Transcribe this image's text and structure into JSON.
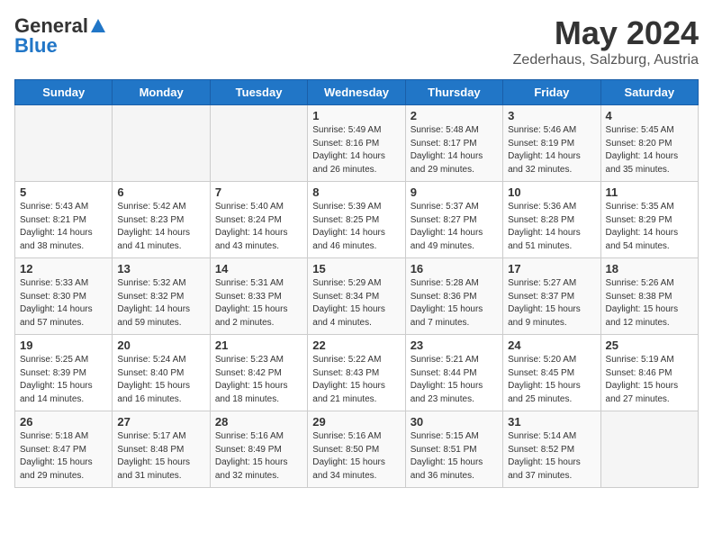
{
  "header": {
    "logo_general": "General",
    "logo_blue": "Blue",
    "title": "May 2024",
    "location": "Zederhaus, Salzburg, Austria"
  },
  "days_of_week": [
    "Sunday",
    "Monday",
    "Tuesday",
    "Wednesday",
    "Thursday",
    "Friday",
    "Saturday"
  ],
  "weeks": [
    [
      {
        "day": "",
        "info": ""
      },
      {
        "day": "",
        "info": ""
      },
      {
        "day": "",
        "info": ""
      },
      {
        "day": "1",
        "info": "Sunrise: 5:49 AM\nSunset: 8:16 PM\nDaylight: 14 hours\nand 26 minutes."
      },
      {
        "day": "2",
        "info": "Sunrise: 5:48 AM\nSunset: 8:17 PM\nDaylight: 14 hours\nand 29 minutes."
      },
      {
        "day": "3",
        "info": "Sunrise: 5:46 AM\nSunset: 8:19 PM\nDaylight: 14 hours\nand 32 minutes."
      },
      {
        "day": "4",
        "info": "Sunrise: 5:45 AM\nSunset: 8:20 PM\nDaylight: 14 hours\nand 35 minutes."
      }
    ],
    [
      {
        "day": "5",
        "info": "Sunrise: 5:43 AM\nSunset: 8:21 PM\nDaylight: 14 hours\nand 38 minutes."
      },
      {
        "day": "6",
        "info": "Sunrise: 5:42 AM\nSunset: 8:23 PM\nDaylight: 14 hours\nand 41 minutes."
      },
      {
        "day": "7",
        "info": "Sunrise: 5:40 AM\nSunset: 8:24 PM\nDaylight: 14 hours\nand 43 minutes."
      },
      {
        "day": "8",
        "info": "Sunrise: 5:39 AM\nSunset: 8:25 PM\nDaylight: 14 hours\nand 46 minutes."
      },
      {
        "day": "9",
        "info": "Sunrise: 5:37 AM\nSunset: 8:27 PM\nDaylight: 14 hours\nand 49 minutes."
      },
      {
        "day": "10",
        "info": "Sunrise: 5:36 AM\nSunset: 8:28 PM\nDaylight: 14 hours\nand 51 minutes."
      },
      {
        "day": "11",
        "info": "Sunrise: 5:35 AM\nSunset: 8:29 PM\nDaylight: 14 hours\nand 54 minutes."
      }
    ],
    [
      {
        "day": "12",
        "info": "Sunrise: 5:33 AM\nSunset: 8:30 PM\nDaylight: 14 hours\nand 57 minutes."
      },
      {
        "day": "13",
        "info": "Sunrise: 5:32 AM\nSunset: 8:32 PM\nDaylight: 14 hours\nand 59 minutes."
      },
      {
        "day": "14",
        "info": "Sunrise: 5:31 AM\nSunset: 8:33 PM\nDaylight: 15 hours\nand 2 minutes."
      },
      {
        "day": "15",
        "info": "Sunrise: 5:29 AM\nSunset: 8:34 PM\nDaylight: 15 hours\nand 4 minutes."
      },
      {
        "day": "16",
        "info": "Sunrise: 5:28 AM\nSunset: 8:36 PM\nDaylight: 15 hours\nand 7 minutes."
      },
      {
        "day": "17",
        "info": "Sunrise: 5:27 AM\nSunset: 8:37 PM\nDaylight: 15 hours\nand 9 minutes."
      },
      {
        "day": "18",
        "info": "Sunrise: 5:26 AM\nSunset: 8:38 PM\nDaylight: 15 hours\nand 12 minutes."
      }
    ],
    [
      {
        "day": "19",
        "info": "Sunrise: 5:25 AM\nSunset: 8:39 PM\nDaylight: 15 hours\nand 14 minutes."
      },
      {
        "day": "20",
        "info": "Sunrise: 5:24 AM\nSunset: 8:40 PM\nDaylight: 15 hours\nand 16 minutes."
      },
      {
        "day": "21",
        "info": "Sunrise: 5:23 AM\nSunset: 8:42 PM\nDaylight: 15 hours\nand 18 minutes."
      },
      {
        "day": "22",
        "info": "Sunrise: 5:22 AM\nSunset: 8:43 PM\nDaylight: 15 hours\nand 21 minutes."
      },
      {
        "day": "23",
        "info": "Sunrise: 5:21 AM\nSunset: 8:44 PM\nDaylight: 15 hours\nand 23 minutes."
      },
      {
        "day": "24",
        "info": "Sunrise: 5:20 AM\nSunset: 8:45 PM\nDaylight: 15 hours\nand 25 minutes."
      },
      {
        "day": "25",
        "info": "Sunrise: 5:19 AM\nSunset: 8:46 PM\nDaylight: 15 hours\nand 27 minutes."
      }
    ],
    [
      {
        "day": "26",
        "info": "Sunrise: 5:18 AM\nSunset: 8:47 PM\nDaylight: 15 hours\nand 29 minutes."
      },
      {
        "day": "27",
        "info": "Sunrise: 5:17 AM\nSunset: 8:48 PM\nDaylight: 15 hours\nand 31 minutes."
      },
      {
        "day": "28",
        "info": "Sunrise: 5:16 AM\nSunset: 8:49 PM\nDaylight: 15 hours\nand 32 minutes."
      },
      {
        "day": "29",
        "info": "Sunrise: 5:16 AM\nSunset: 8:50 PM\nDaylight: 15 hours\nand 34 minutes."
      },
      {
        "day": "30",
        "info": "Sunrise: 5:15 AM\nSunset: 8:51 PM\nDaylight: 15 hours\nand 36 minutes."
      },
      {
        "day": "31",
        "info": "Sunrise: 5:14 AM\nSunset: 8:52 PM\nDaylight: 15 hours\nand 37 minutes."
      },
      {
        "day": "",
        "info": ""
      }
    ]
  ]
}
